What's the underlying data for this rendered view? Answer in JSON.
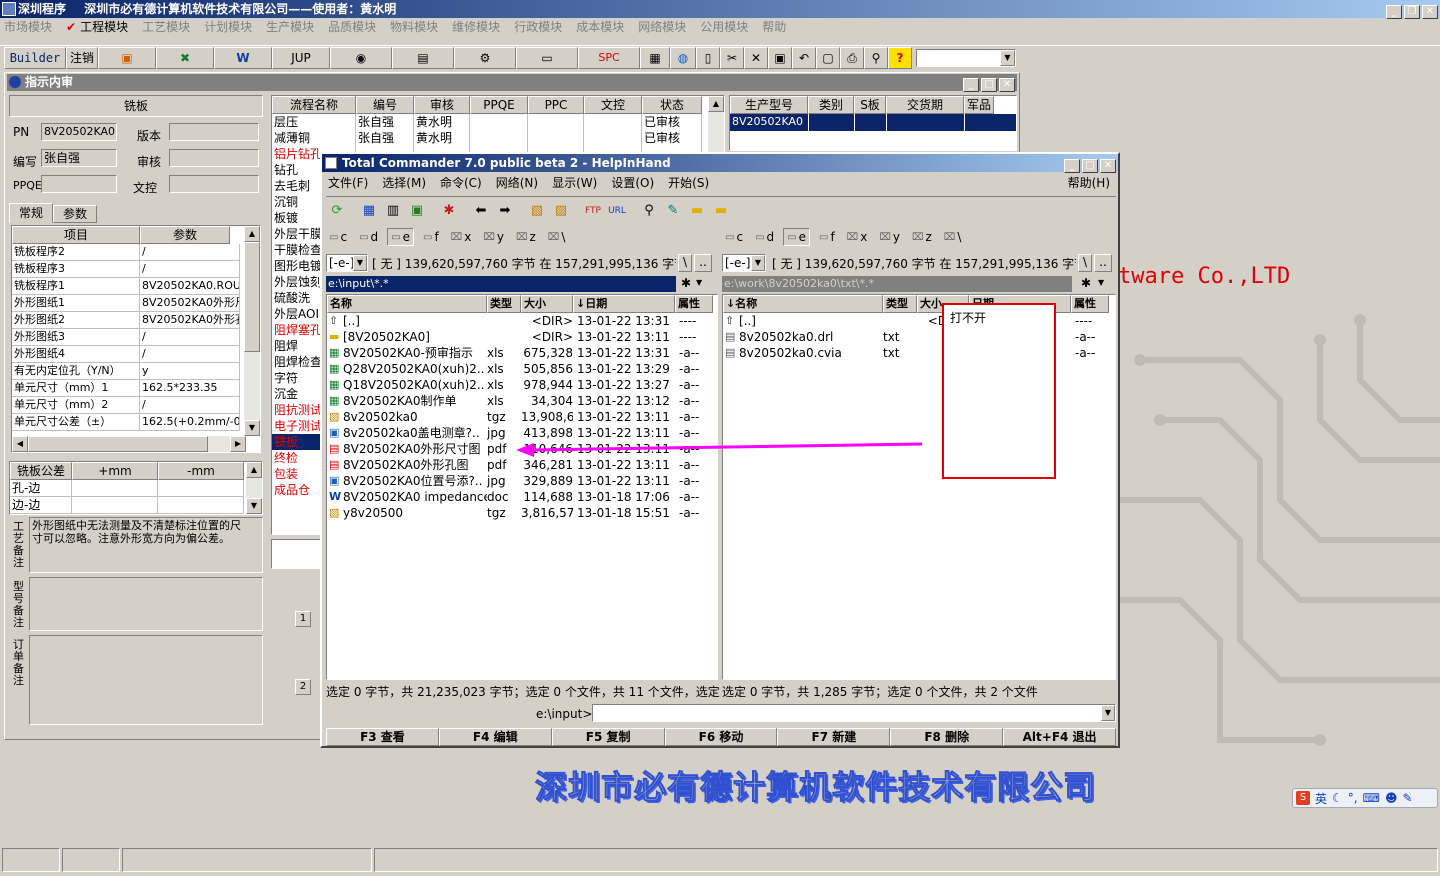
{
  "titlebar": {
    "app": "深圳程序",
    "company": "深圳市必有德计算机软件技术有限公司——使用者：黄水明"
  },
  "menu": [
    "市场模块",
    "工程模块",
    "工艺模块",
    "计划模块",
    "生产模块",
    "品质模块",
    "物料模块",
    "维修模块",
    "行政模块",
    "成本模块",
    "网络模块",
    "公用模块",
    "帮助"
  ],
  "toolbar": {
    "builder": "Builder",
    "cancel": "注销",
    "jup": "JUP",
    "spc": "SPC"
  },
  "child": {
    "title": "指示内审",
    "heading": "铣板",
    "fields": {
      "pn_label": "PN",
      "pn_value": "8V20502KA0",
      "version_label": "版本",
      "writer_label": "编写",
      "writer_value": "张自强",
      "review_label": "审核",
      "ppqe_label": "PPQE",
      "doc_label": "文控"
    },
    "tabs": [
      "常规",
      "参数"
    ],
    "param_headers": [
      "项目",
      "参数"
    ],
    "params": [
      [
        "铣板程序2",
        "/"
      ],
      [
        "铣板程序3",
        "/"
      ],
      [
        "铣板程序1",
        "8V20502KA0.ROU"
      ],
      [
        "外形图纸1",
        "8V20502KA0外形尺"
      ],
      [
        "外形图纸2",
        "8V20502KA0外形孔"
      ],
      [
        "外形图纸3",
        "/"
      ],
      [
        "外形图纸4",
        "/"
      ],
      [
        "有无内定位孔（Y/N）",
        "y"
      ],
      [
        "单元尺寸（mm）1",
        "162.5*233.35"
      ],
      [
        "单元尺寸（mm）2",
        "/"
      ],
      [
        "单元尺寸公差（±）",
        "162.5(+0.2mm/-0"
      ]
    ],
    "tol_headers": [
      "铣板公差",
      "+mm",
      "-mm"
    ],
    "tol_rows": [
      "孔-边",
      "边-边"
    ],
    "craft_label": "工艺备注",
    "craft_note": "外形图纸中无法测量及不清楚标注位置的尺寸可以忽略。注意外形宽方向为偏公差。",
    "model_label": "型号备注",
    "order_label": "订单备注",
    "flow_headers": [
      "流程名称",
      "编号",
      "审核",
      "PPQE",
      "PPC",
      "文控",
      "状态"
    ],
    "flows": [
      {
        "name": "层压",
        "no": "张自强",
        "rev": "黄水明",
        "status": "已审核",
        "red": false
      },
      {
        "name": "减薄铜",
        "no": "张自强",
        "rev": "黄水明",
        "status": "已审核",
        "red": false
      },
      {
        "name": "铝片钻孔",
        "red": true
      },
      {
        "name": "钻孔",
        "red": false
      },
      {
        "name": "去毛刺",
        "red": false
      },
      {
        "name": "沉铜",
        "red": false
      },
      {
        "name": "板镀",
        "red": false
      },
      {
        "name": "外层干膜",
        "red": false
      },
      {
        "name": "干膜检查",
        "red": false
      },
      {
        "name": "图形电镀",
        "red": false
      },
      {
        "name": "外层蚀刻",
        "red": false
      },
      {
        "name": "硫酸洗",
        "red": false
      },
      {
        "name": "外层AOI",
        "red": false
      },
      {
        "name": "阻焊塞孔",
        "red": true
      },
      {
        "name": "阻焊",
        "red": false
      },
      {
        "name": "阻焊检查",
        "red": false
      },
      {
        "name": "字符",
        "red": false
      },
      {
        "name": "沉金",
        "red": false
      },
      {
        "name": "阻抗测试",
        "red": true
      },
      {
        "name": "电子测试",
        "red": true
      },
      {
        "name": "铣板",
        "red": true,
        "sel": true
      },
      {
        "name": "终检",
        "red": true
      },
      {
        "name": "包装",
        "red": true
      },
      {
        "name": "成品仓",
        "red": true
      }
    ],
    "prod_headers": [
      "生产型号",
      "类别",
      "S板",
      "交货期",
      "军品"
    ],
    "prod_row": "8V20502KA0",
    "pages": [
      "1",
      "2"
    ]
  },
  "bg_text": "tware Co.,LTD",
  "bg_company": "深圳市必有德计算机软件技术有限公司",
  "tc": {
    "title": "Total Commander 7.0 public beta 2 - HelpInHand",
    "menu": [
      "文件(F)",
      "选择(M)",
      "命令(C)",
      "网络(N)",
      "显示(W)",
      "设置(O)",
      "开始(S)"
    ],
    "help": "帮助(H)",
    "drives": [
      "c",
      "d",
      "e",
      "f",
      "x",
      "y",
      "z",
      "\\"
    ],
    "drive_sel": "[-e-]",
    "freespace": "[ 无 ]  139,620,597,760 字节 在 157,291,995,136 字节",
    "left_path": "e:\\input\\*.*",
    "right_path": "e:\\work\\8v20502ka0\\txt\\*.*",
    "cols_left": [
      "名称",
      "类型",
      "大小",
      "↓日期",
      "属性"
    ],
    "cols_right": [
      "↓名称",
      "类型",
      "大小",
      "日期",
      "属性"
    ],
    "left_files": [
      {
        "name": "[..]",
        "ext": "",
        "size": "<DIR>",
        "date": "13-01-22 13:31",
        "attr": "----",
        "icon": "up"
      },
      {
        "name": "[8V20502KA0]",
        "ext": "",
        "size": "<DIR>",
        "date": "13-01-22 13:11",
        "attr": "----",
        "icon": "folder"
      },
      {
        "name": "8V20502KA0-预审指示",
        "ext": "xls",
        "size": "675,328",
        "date": "13-01-22 13:31",
        "attr": "-a--",
        "icon": "xls"
      },
      {
        "name": "Q28V20502KA0(xuh)2..",
        "ext": "xls",
        "size": "505,856",
        "date": "13-01-22 13:29",
        "attr": "-a--",
        "icon": "xls"
      },
      {
        "name": "Q18V20502KA0(xuh)2..",
        "ext": "xls",
        "size": "978,944",
        "date": "13-01-22 13:27",
        "attr": "-a--",
        "icon": "xls"
      },
      {
        "name": "8V20502KA0制作单",
        "ext": "xls",
        "size": "34,304",
        "date": "13-01-22 13:12",
        "attr": "-a--",
        "icon": "xls"
      },
      {
        "name": "8v20502ka0",
        "ext": "tgz",
        "size": "13,908,612",
        "date": "13-01-22 13:11",
        "attr": "-a--",
        "icon": "zip"
      },
      {
        "name": "8v20502ka0盖电测章?..",
        "ext": "jpg",
        "size": "413,898",
        "date": "13-01-22 13:11",
        "attr": "-a--",
        "icon": "jpg"
      },
      {
        "name": "8V20502KA0外形尺寸图",
        "ext": "pdf",
        "size": "110,646",
        "date": "13-01-22 13:11",
        "attr": "-a--",
        "icon": "pdf"
      },
      {
        "name": "8V20502KA0外形孔图",
        "ext": "pdf",
        "size": "346,281",
        "date": "13-01-22 13:11",
        "attr": "-a--",
        "icon": "pdf"
      },
      {
        "name": "8V20502KA0位置号添?..",
        "ext": "jpg",
        "size": "329,889",
        "date": "13-01-22 13:11",
        "attr": "-a--",
        "icon": "jpg"
      },
      {
        "name": "8V20502KA0 impedance",
        "ext": "doc",
        "size": "114,688",
        "date": "13-01-18 17:06",
        "attr": "-a--",
        "icon": "doc"
      },
      {
        "name": "y8v20500",
        "ext": "tgz",
        "size": "3,816,577",
        "date": "13-01-18 15:51",
        "attr": "-a--",
        "icon": "zip"
      }
    ],
    "right_files": [
      {
        "name": "[..]",
        "ext": "",
        "size": "<DIR>",
        "date": "",
        "attr": "----",
        "icon": "up"
      },
      {
        "name": "8v20502ka0.drl",
        "ext": "txt",
        "size": "1",
        "date": "",
        "attr": "-a--",
        "icon": "txt"
      },
      {
        "name": "8v20502ka0.cvia",
        "ext": "txt",
        "size": "",
        "date": "",
        "attr": "-a--",
        "icon": "txt"
      }
    ],
    "status_left": "选定 0 字节，共 21,235,023 字节；选定 0 个文件，共 11 个文件，选定",
    "status_right": "选定 0 字节，共 1,285 字节；选定 0 个文件，共 2 个文件",
    "cmd_label": "e:\\input>",
    "fkeys": [
      "F3 查看",
      "F4 编辑",
      "F5 复制",
      "F6 移动",
      "F7 新建",
      "F8 删除",
      "Alt+F4 退出"
    ]
  },
  "annotation": "打不开",
  "ime": "英",
  "colors": {
    "title": "#0a246a",
    "red": "#e00000",
    "arrow": "#ff00ff"
  }
}
